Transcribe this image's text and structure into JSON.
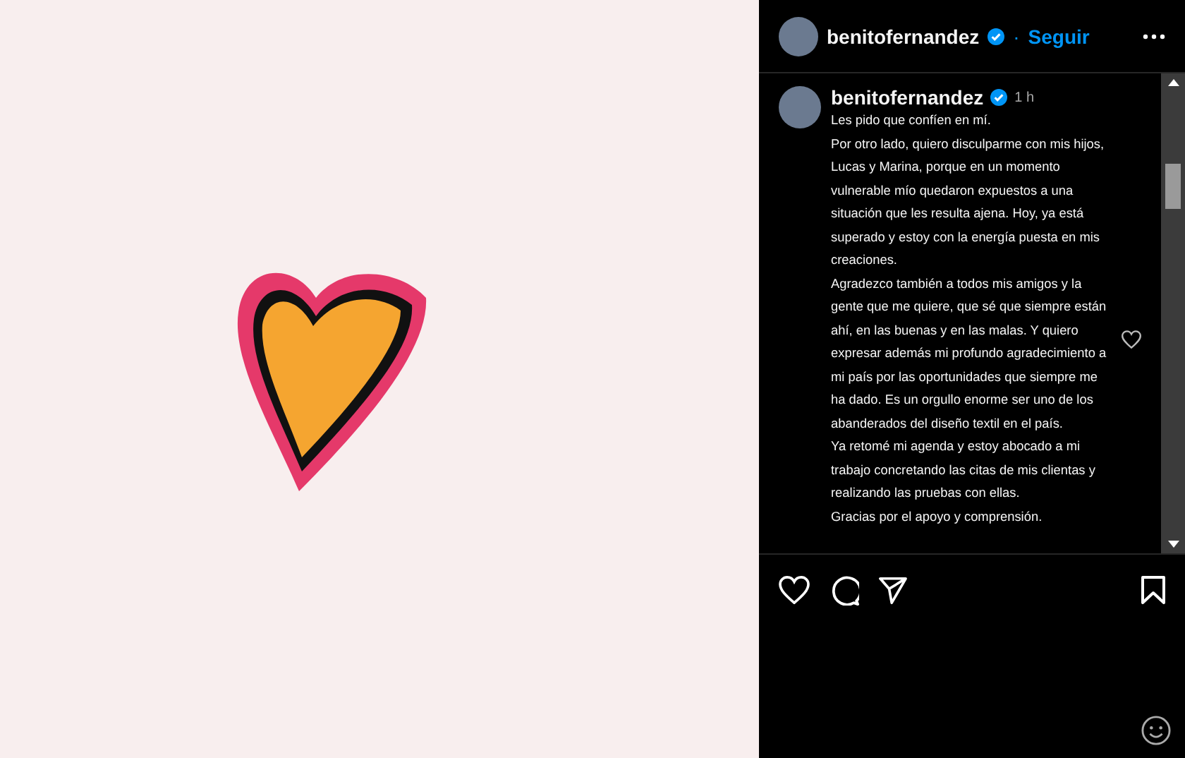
{
  "header": {
    "username": "benitofernandez",
    "verified": true,
    "separator": "·",
    "follow": "Seguir"
  },
  "caption": {
    "username": "benitofernandez",
    "verified": true,
    "time": "1 h",
    "paragraphs": [
      "Les pido que confíen en mí.",
      "Por otro lado, quiero disculparme con mis hijos, Lucas y Marina, porque en un momento vulnerable mío quedaron expuestos a una situación que les resulta ajena. Hoy, ya está superado y estoy con la energía puesta en mis creaciones.",
      "Agradezco también a todos mis amigos y la gente que me quiere, que sé que siempre están ahí, en las buenas y en las malas. Y quiero expresar además mi profundo agradecimiento a mi país por las oportunidades que siempre me ha dado. Es un orgullo enorme ser uno de los abanderados del diseño textil en el país.",
      "Ya retomé mi agenda y estoy abocado a mi trabajo concretando las citas de mis clientas y realizando las pruebas con ellas.",
      "Gracias por el apoyo y comprensión."
    ]
  }
}
